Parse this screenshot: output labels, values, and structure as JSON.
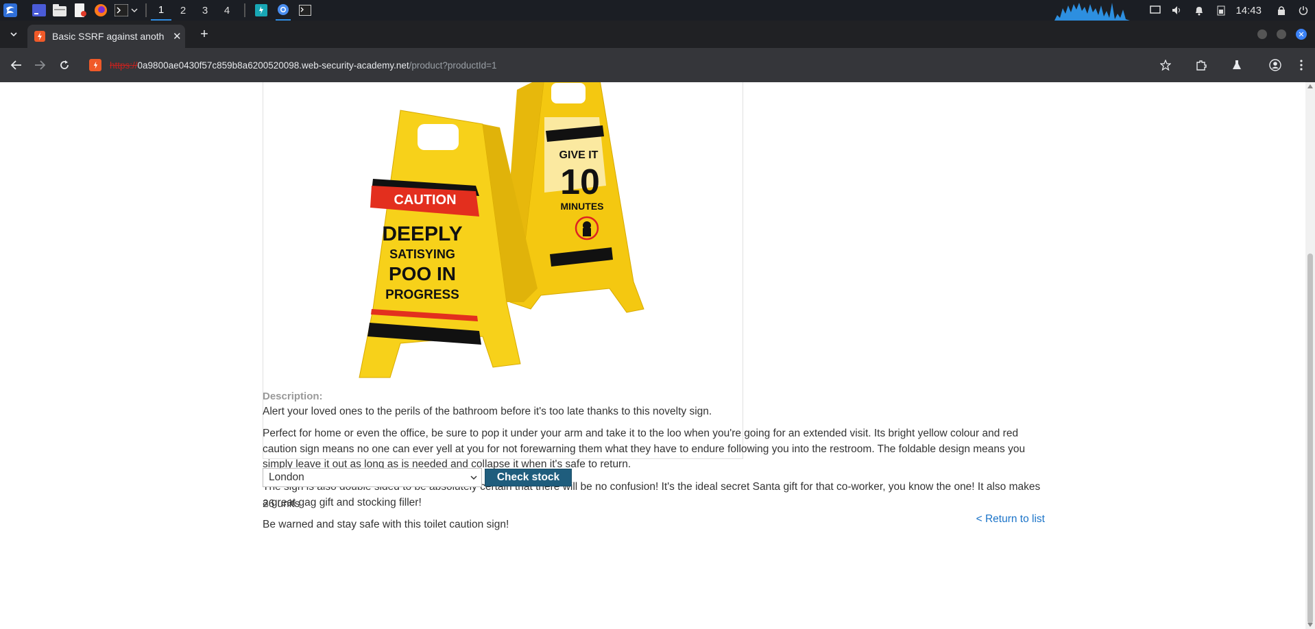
{
  "taskbar": {
    "workspaces": [
      "1",
      "2",
      "3",
      "4"
    ],
    "active_workspace": "1",
    "clock": "14:43"
  },
  "browser": {
    "tab_title": "Basic SSRF against anoth",
    "new_tab": "+",
    "url_scheme": "https://",
    "url_host": "0a9800ae0430f57c859b8a6200520098.web-security-academy.net",
    "url_path": "/product?productId=1"
  },
  "product": {
    "image_text": {
      "left_sign_banner": "CAUTION",
      "left_sign_line1": "DEEPLY",
      "left_sign_line2": "SATISYING",
      "left_sign_line3": "POO IN",
      "left_sign_line4": "PROGRESS",
      "right_sign_line1": "GIVE IT",
      "right_sign_line2": "10",
      "right_sign_line3": "MINUTES"
    },
    "description_label": "Description:",
    "paragraphs": [
      "Alert your loved ones to the perils of the bathroom before it's too late thanks to this novelty sign.",
      "Perfect for home or even the office, be sure to pop it under your arm and take it to the loo when you're going for an extended visit. Its bright yellow colour and red caution sign means no one can ever yell at you for not forewarning them what they have to endure following you into the restroom. The foldable design means you simply leave it out as long as is needed and collapse it when it's safe to return.",
      "The sign is also double sided to be absolutely certain that there will be no confusion! It's the ideal secret Santa gift for that co-worker, you know the one! It also makes a great gag gift and stocking filler!",
      "Be warned and stay safe with this toilet caution sign!"
    ],
    "store_selected": "London",
    "check_stock_label": "Check stock",
    "stock_result": "26 units",
    "return_link": "< Return to list"
  },
  "colors": {
    "button": "#1f5d7d",
    "link": "#1a73c8",
    "sign_yellow": "#f7d11a"
  }
}
